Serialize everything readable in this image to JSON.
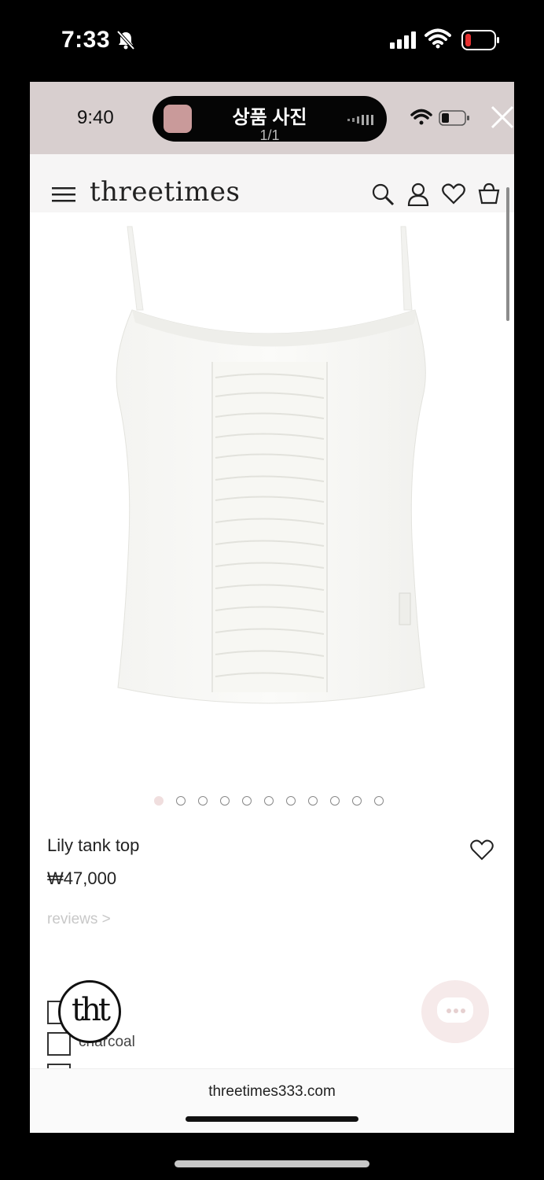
{
  "os_status": {
    "time": "7:33"
  },
  "viewer": {
    "time": "9:40",
    "title": "상품 사진",
    "counter": "1/1"
  },
  "site": {
    "brand": "threetimes",
    "url": "threetimes333.com"
  },
  "product": {
    "name": "Lily tank top",
    "price": "₩47,000",
    "reviews_link": "reviews >",
    "image_count": 11,
    "active_image": 1,
    "options": [
      "",
      "charcoal",
      ""
    ]
  },
  "logo_badge": {
    "text": "tht"
  },
  "colors": {
    "accent_pink": "#f0dede",
    "viewer_bar": "#d8cfcf"
  }
}
